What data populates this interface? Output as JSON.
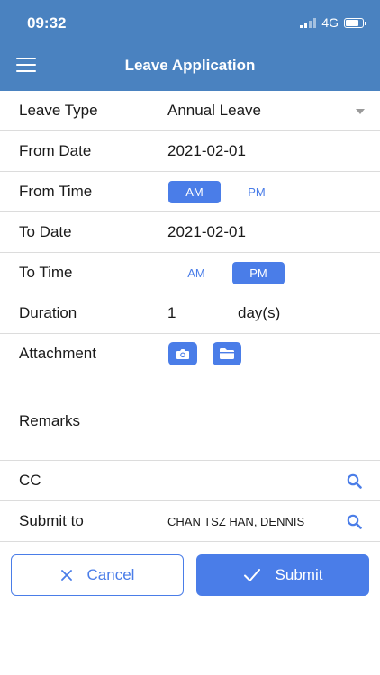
{
  "status_bar": {
    "time": "09:32",
    "network": "4G"
  },
  "header": {
    "title": "Leave Application"
  },
  "form": {
    "leave_type": {
      "label": "Leave Type",
      "value": "Annual Leave"
    },
    "from_date": {
      "label": "From Date",
      "value": "2021-02-01"
    },
    "from_time": {
      "label": "From Time",
      "am": "AM",
      "pm": "PM",
      "selected": "AM"
    },
    "to_date": {
      "label": "To Date",
      "value": "2021-02-01"
    },
    "to_time": {
      "label": "To Time",
      "am": "AM",
      "pm": "PM",
      "selected": "PM"
    },
    "duration": {
      "label": "Duration",
      "value": "1",
      "unit": "day(s)"
    },
    "attachment": {
      "label": "Attachment",
      "camera_icon": "camera-icon",
      "folder_icon": "folder-icon"
    },
    "remarks": {
      "label": "Remarks",
      "value": ""
    },
    "cc": {
      "label": "CC",
      "value": ""
    },
    "submit_to": {
      "label": "Submit to",
      "value": "CHAN TSZ HAN, DENNIS"
    }
  },
  "actions": {
    "cancel_label": "Cancel",
    "submit_label": "Submit"
  },
  "colors": {
    "header": "#4a82c0",
    "accent": "#4a7de8",
    "divider": "#dcdcdc"
  }
}
